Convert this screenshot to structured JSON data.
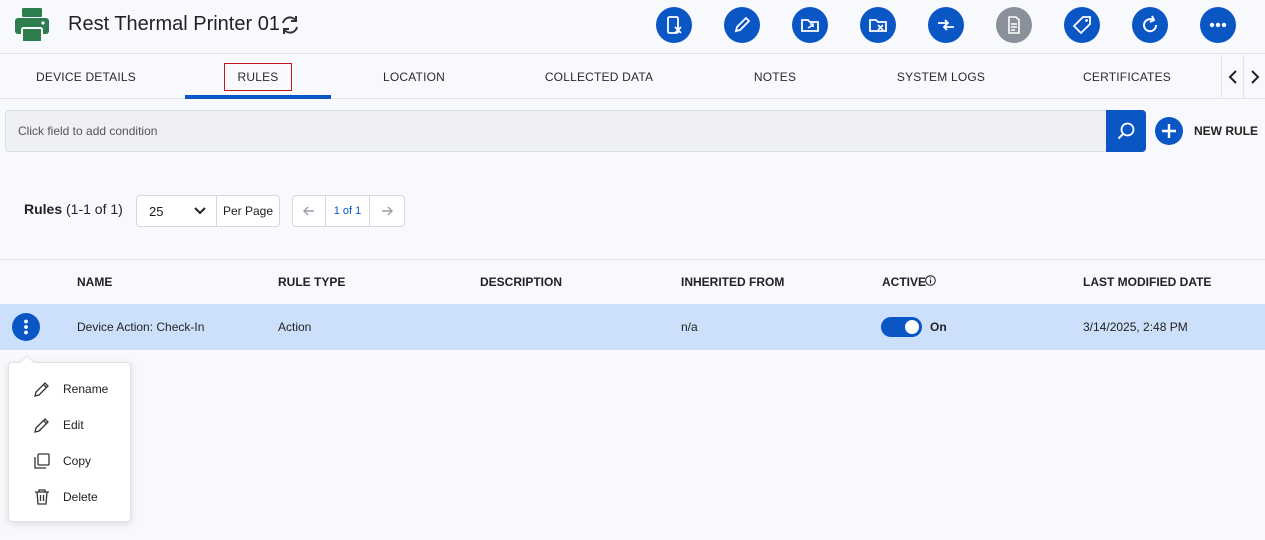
{
  "header": {
    "title": "Rest Thermal Printer 01",
    "actions": [
      {
        "icon": "remove-device-icon",
        "enabled": true
      },
      {
        "icon": "pencil-icon",
        "enabled": true
      },
      {
        "icon": "folder-move-icon",
        "enabled": true
      },
      {
        "icon": "folder-remove-icon",
        "enabled": true
      },
      {
        "icon": "transfer-icon",
        "enabled": true
      },
      {
        "icon": "document-icon",
        "enabled": false
      },
      {
        "icon": "tag-icon",
        "enabled": true
      },
      {
        "icon": "refresh-icon",
        "enabled": true
      },
      {
        "icon": "more-icon",
        "enabled": true
      }
    ]
  },
  "tabs": [
    {
      "label": "DEVICE DETAILS",
      "active": false
    },
    {
      "label": "RULES",
      "active": true
    },
    {
      "label": "LOCATION",
      "active": false
    },
    {
      "label": "COLLECTED DATA",
      "active": false
    },
    {
      "label": "NOTES",
      "active": false
    },
    {
      "label": "SYSTEM LOGS",
      "active": false
    },
    {
      "label": "CERTIFICATES",
      "active": false
    }
  ],
  "search": {
    "placeholder": "Click field to add condition"
  },
  "new_rule_label": "NEW RULE",
  "rules_summary": {
    "title": "Rules",
    "range": "(1-1 of 1)"
  },
  "pagination": {
    "per_page_value": "25",
    "per_page_label": "Per Page",
    "page_info": "1 of 1"
  },
  "table": {
    "columns": [
      "NAME",
      "RULE TYPE",
      "DESCRIPTION",
      "INHERITED FROM",
      "ACTIVE",
      "LAST MODIFIED DATE"
    ],
    "rows": [
      {
        "name": "Device Action: Check-In",
        "rule_type": "Action",
        "description": "",
        "inherited_from": "n/a",
        "active": "On",
        "last_modified": "3/14/2025, 2:48 PM"
      }
    ]
  },
  "context_menu": [
    {
      "label": "Rename",
      "icon": "pencil-icon"
    },
    {
      "label": "Edit",
      "icon": "pencil-icon"
    },
    {
      "label": "Copy",
      "icon": "copy-icon"
    },
    {
      "label": "Delete",
      "icon": "trash-icon"
    }
  ],
  "colors": {
    "accent": "#0a56c4",
    "selected_row": "#cce0fb",
    "printer": "#2e7d4f",
    "active_tab_outline": "#c6141e"
  }
}
